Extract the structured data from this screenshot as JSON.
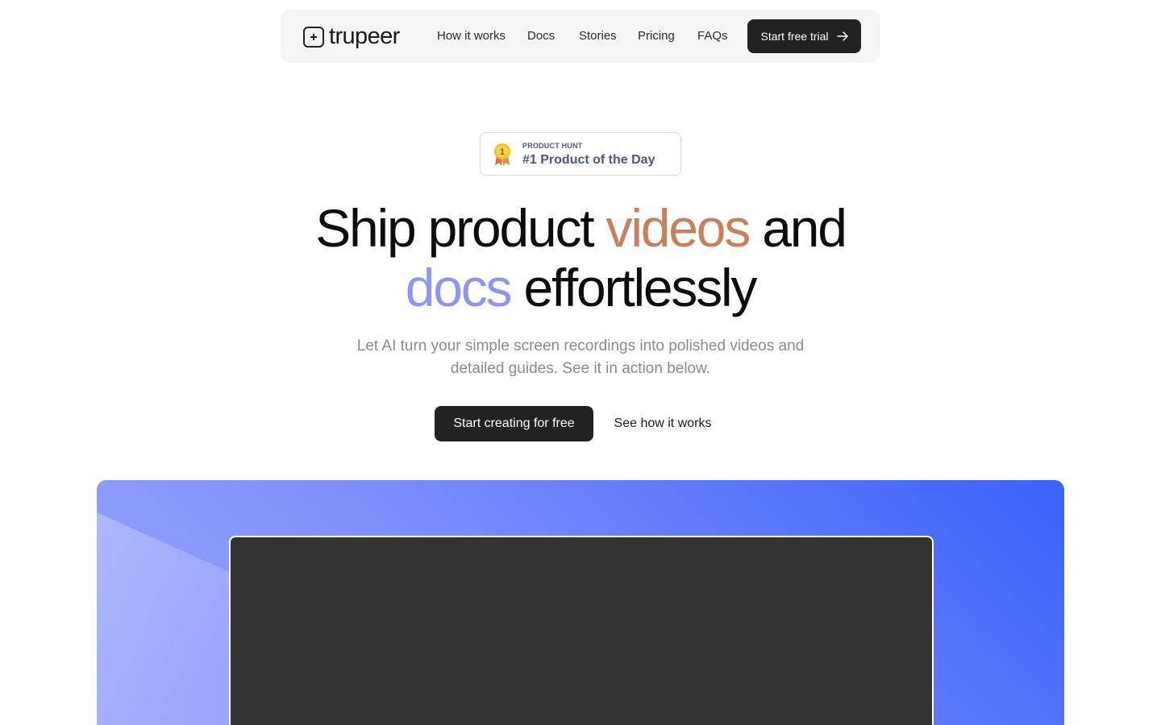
{
  "nav": {
    "logo_text": "trupeer",
    "links": [
      "How it works",
      "Docs",
      "Stories",
      "Pricing",
      "FAQs"
    ],
    "cta_label": "Start free trial"
  },
  "badge": {
    "small": "PRODUCT HUNT",
    "main": "#1 Product of the Day",
    "medal_number": "1"
  },
  "hero": {
    "headline_part1": "Ship product ",
    "headline_highlight1": "videos",
    "headline_part2": " and",
    "headline_highlight2": "docs",
    "headline_part3": " effortlessly",
    "subheading": "Let AI turn your simple screen recordings into polished videos and detailed guides. See it in action below.",
    "primary_cta": "Start creating for free",
    "secondary_cta": "See how it works"
  },
  "colors": {
    "highlight_videos": "#c87f5c",
    "highlight_docs": "#8d96f5",
    "button_dark": "#222222",
    "hero_gradient_start": "#3a62fb",
    "hero_gradient_end": "#9ba6fb",
    "video_background": "#333333"
  }
}
